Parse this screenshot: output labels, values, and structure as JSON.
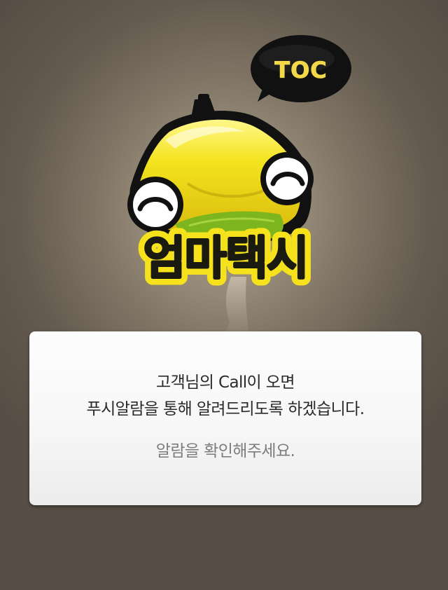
{
  "logo": {
    "brand_name": "엄마택시",
    "speech_bubble_text": "TOC"
  },
  "dialog": {
    "message_line1": "고객님의 Call이 오면",
    "message_line2": "푸시알람을 통해 알려드리도록 하겠습니다.",
    "message_line3": "알람을 확인해주세요."
  },
  "colors": {
    "background": "#6f6558",
    "taxi_yellow": "#f5e21c",
    "taxi_green": "#7cb51e",
    "dialog_background": "#f7f7f7",
    "primary_text": "#2a2a2a",
    "secondary_text": "#7d7d7d"
  }
}
